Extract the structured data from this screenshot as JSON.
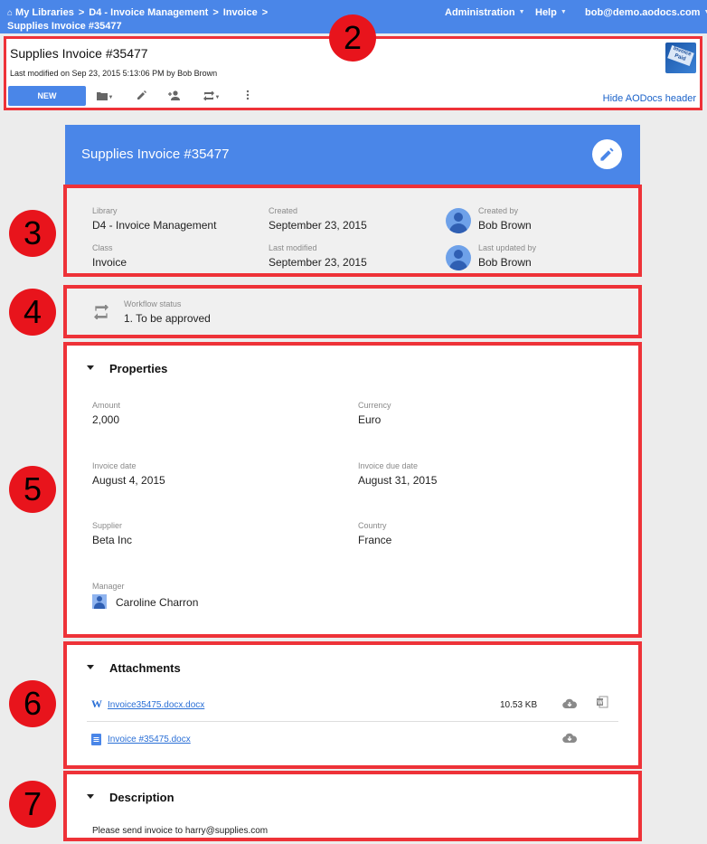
{
  "topbar": {
    "breadcrumb": [
      "My Libraries",
      "D4 - Invoice Management",
      "Invoice",
      "Supplies Invoice #35477"
    ],
    "nav": [
      "Administration",
      "Help",
      "bob@demo.aodocs.com"
    ]
  },
  "header": {
    "title": "Supplies Invoice #35477",
    "last_modified": "Last modified on Sep 23, 2015 5:13:06 PM by Bob Brown",
    "thumbnail_text": "Invoice Paid",
    "new_label": "NEW",
    "hide_link": "Hide AODocs header",
    "tool_icons": [
      "folder-icon",
      "pencil-icon",
      "add-person-icon",
      "workflow-icon",
      "more-vert-icon"
    ]
  },
  "markers": [
    "2",
    "3",
    "4",
    "5",
    "6",
    "7"
  ],
  "document": {
    "title": "Supplies Invoice #35477"
  },
  "meta": {
    "library_label": "Library",
    "library": "D4 - Invoice Management",
    "class_label": "Class",
    "class": "Invoice",
    "created_label": "Created",
    "created": "September 23, 2015",
    "last_modified_label": "Last modified",
    "last_modified": "September 23, 2015",
    "created_by_label": "Created by",
    "created_by": "Bob Brown",
    "last_updated_by_label": "Last updated by",
    "last_updated_by": "Bob Brown"
  },
  "workflow": {
    "label": "Workflow status",
    "value": "1. To be approved"
  },
  "properties": {
    "heading": "Properties",
    "fields": [
      {
        "label": "Amount",
        "value": "2,000"
      },
      {
        "label": "Currency",
        "value": "Euro"
      },
      {
        "label": "Invoice date",
        "value": "August 4, 2015"
      },
      {
        "label": "Invoice due date",
        "value": "August 31, 2015"
      },
      {
        "label": "Supplier",
        "value": "Beta Inc"
      },
      {
        "label": "Country",
        "value": "France"
      },
      {
        "label": "Manager",
        "value": "Caroline Charron"
      }
    ]
  },
  "attachments": {
    "heading": "Attachments",
    "files": [
      {
        "name": "Invoice35475.docx.docx",
        "size": "10.53 KB"
      },
      {
        "name": "Invoice #35475.docx",
        "size": ""
      }
    ]
  },
  "description": {
    "heading": "Description",
    "text": "Please send invoice to harry@supplies.com"
  },
  "colors": {
    "accent": "#4a86e8",
    "highlight_border": "#ee3238",
    "marker": "#e8141c",
    "link": "#1a62c9"
  }
}
